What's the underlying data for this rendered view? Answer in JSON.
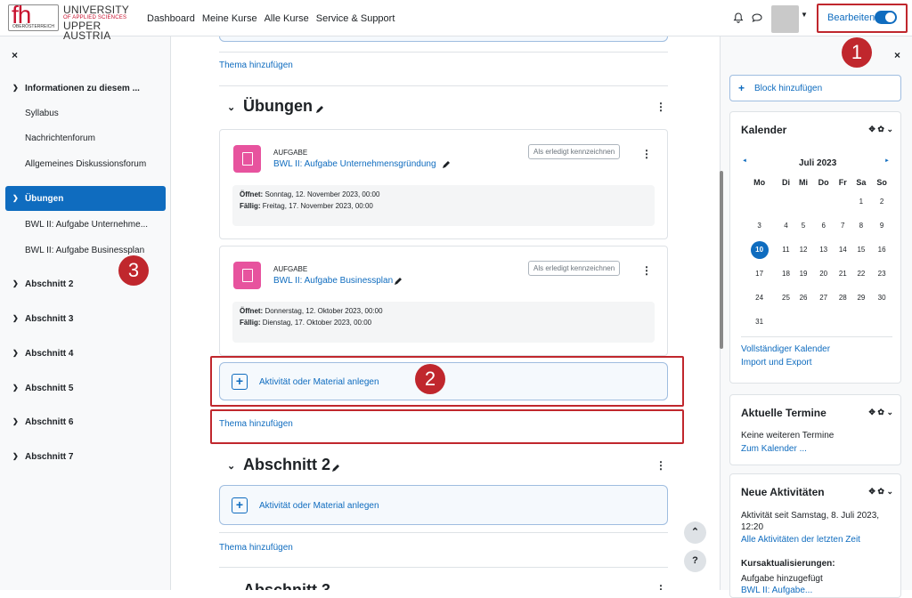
{
  "header": {
    "logo_fh": "fh",
    "logo_sub": "OBERÖSTERREICH",
    "logo_line1": "UNIVERSITY",
    "logo_line2": "OF APPLIED SCIENCES",
    "logo_line3": "UPPER AUSTRIA",
    "nav": [
      "Dashboard",
      "Meine Kurse",
      "Alle Kurse",
      "Service & Support"
    ],
    "edit_label": "Bearbeiten"
  },
  "badges": [
    "1",
    "2",
    "3"
  ],
  "sidebar": {
    "close": "×",
    "items": [
      {
        "label": "Informationen zu diesem ...",
        "heading": true
      },
      {
        "label": "Syllabus"
      },
      {
        "label": "Nachrichtenforum"
      },
      {
        "label": "Allgemeines Diskussionsforum"
      },
      {
        "label": "Übungen",
        "heading": true,
        "active": true
      },
      {
        "label": "BWL II: Aufgabe Unternehme..."
      },
      {
        "label": "BWL II: Aufgabe Businessplan"
      },
      {
        "label": "Abschnitt 2",
        "heading": true
      },
      {
        "label": "Abschnitt 3",
        "heading": true
      },
      {
        "label": "Abschnitt 4",
        "heading": true
      },
      {
        "label": "Abschnitt 5",
        "heading": true
      },
      {
        "label": "Abschnitt 6",
        "heading": true
      },
      {
        "label": "Abschnitt 7",
        "heading": true
      }
    ]
  },
  "main": {
    "add_topic": "Thema hinzufügen",
    "add_activity": "Aktivität oder Material anlegen",
    "sections": [
      {
        "title": "Übungen"
      },
      {
        "title": "Abschnitt 2"
      },
      {
        "title": "Abschnitt 3"
      }
    ],
    "activities": [
      {
        "type": "AUFGABE",
        "name": "BWL II: Aufgabe Unternehmensgründung",
        "mark_done": "Als erledigt kennzeichnen",
        "opens_label": "Öffnet:",
        "opens": "Sonntag, 12. November 2023, 00:00",
        "due_label": "Fällig:",
        "due": "Freitag, 17. November 2023, 00:00"
      },
      {
        "type": "AUFGABE",
        "name": "BWL II: Aufgabe Businessplan",
        "mark_done": "Als erledigt kennzeichnen",
        "opens_label": "Öffnet:",
        "opens": "Donnerstag, 12. Oktober 2023, 00:00",
        "due_label": "Fällig:",
        "due": "Dienstag, 17. Oktober 2023, 00:00"
      }
    ]
  },
  "right": {
    "close": "×",
    "add_block": "Block hinzufügen",
    "calendar": {
      "title": "Kalender",
      "month": "Juli 2023",
      "prev": "◄",
      "next": "►",
      "weekdays": [
        "Mo",
        "Di",
        "Mi",
        "Do",
        "Fr",
        "Sa",
        "So"
      ],
      "weeks": [
        [
          "",
          "",
          "",
          "",
          "",
          "1",
          "2"
        ],
        [
          "3",
          "4",
          "5",
          "6",
          "7",
          "8",
          "9"
        ],
        [
          "10",
          "11",
          "12",
          "13",
          "14",
          "15",
          "16"
        ],
        [
          "17",
          "18",
          "19",
          "20",
          "21",
          "22",
          "23"
        ],
        [
          "24",
          "25",
          "26",
          "27",
          "28",
          "29",
          "30"
        ],
        [
          "31",
          "",
          "",
          "",
          "",
          "",
          ""
        ]
      ],
      "today": "10",
      "full_link": "Vollständiger Kalender",
      "import_link": "Import und Export"
    },
    "termine": {
      "title": "Aktuelle Termine",
      "none": "Keine weiteren Termine",
      "link": "Zum Kalender ..."
    },
    "neue": {
      "title": "Neue Aktivitäten",
      "since": "Aktivität seit Samstag, 8. Juli 2023, 12:20",
      "all_link": "Alle Aktivitäten der letzten Zeit",
      "updates_title": "Kursaktualisierungen:",
      "update1": "Aufgabe hinzugefügt",
      "update2": "BWL II: Aufgabe..."
    }
  },
  "fab": {
    "up": "⌃",
    "help": "?"
  }
}
